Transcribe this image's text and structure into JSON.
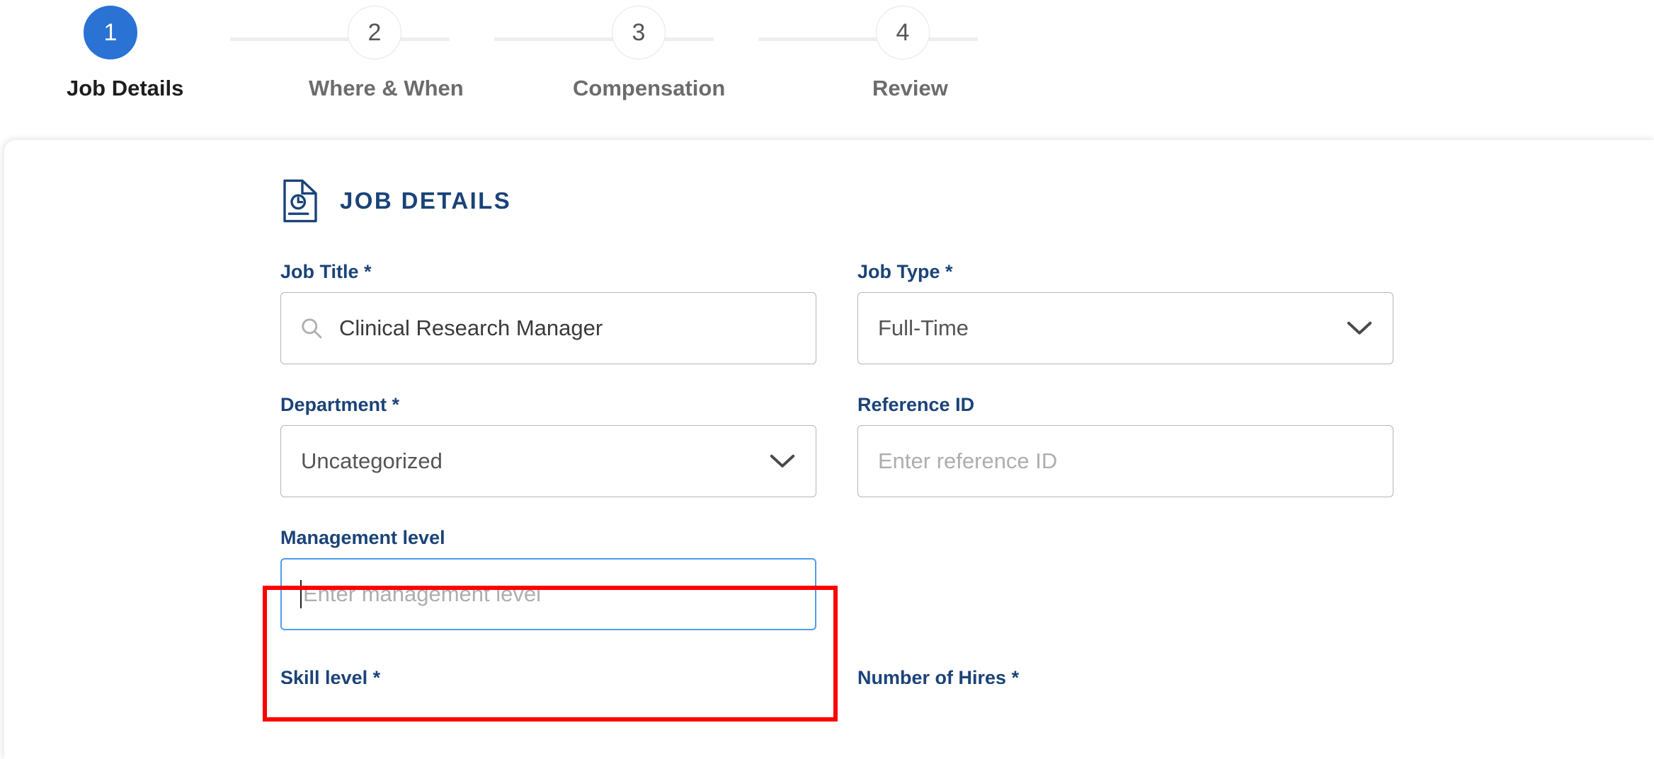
{
  "colors": {
    "accent_blue": "#2a72d4",
    "label_navy": "#1b4378",
    "highlight_red": "#ff0000",
    "focus_blue": "#529bea",
    "border_gray": "#b6b6b6",
    "connector_gray": "#eceef1"
  },
  "stepper": {
    "steps": [
      {
        "number": "1",
        "label": "Job Details",
        "state": "active"
      },
      {
        "number": "2",
        "label": "Where & When",
        "state": "inactive"
      },
      {
        "number": "3",
        "label": "Compensation",
        "state": "inactive"
      },
      {
        "number": "4",
        "label": "Review",
        "state": "inactive"
      }
    ]
  },
  "section": {
    "icon": "document-clock-icon",
    "title": "JOB DETAILS"
  },
  "fields": {
    "job_title": {
      "label": "Job Title",
      "required_mark": "*",
      "icon": "search-icon",
      "value": "Clinical Research Manager"
    },
    "job_type": {
      "label": "Job Type",
      "required_mark": "*",
      "value": "Full-Time",
      "icon": "chevron-down-icon"
    },
    "department": {
      "label": "Department",
      "required_mark": "*",
      "value": "Uncategorized",
      "icon": "chevron-down-icon"
    },
    "reference_id": {
      "label": "Reference ID",
      "required_mark": "",
      "placeholder": "Enter reference ID",
      "value": ""
    },
    "management_level": {
      "label": "Management level",
      "required_mark": "",
      "placeholder": "Enter management level",
      "value": "",
      "focused": true,
      "highlighted": true
    },
    "skill_level": {
      "label": "Skill level",
      "required_mark": "*"
    },
    "number_of_hires": {
      "label": "Number of Hires",
      "required_mark": "*"
    }
  }
}
